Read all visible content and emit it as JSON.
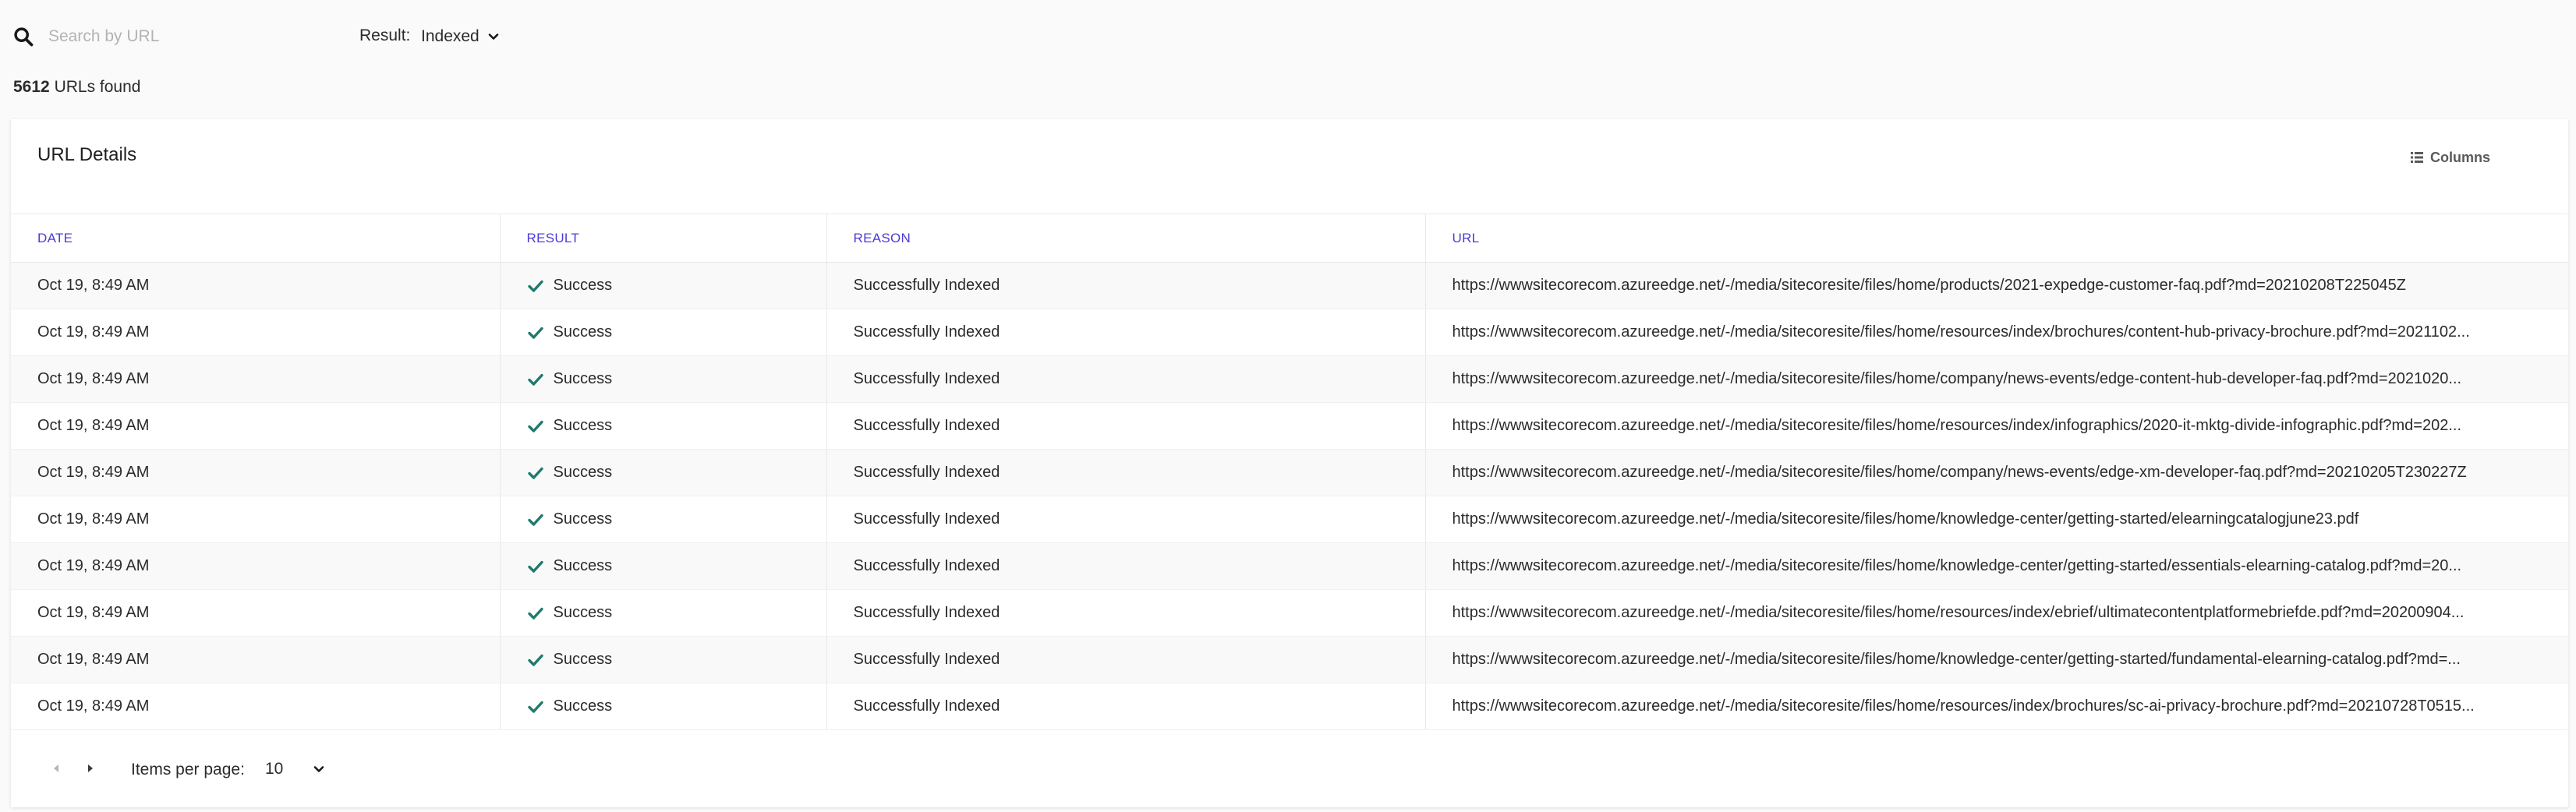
{
  "search": {
    "placeholder": "Search by URL",
    "value": ""
  },
  "filter": {
    "label": "Result:",
    "value": "Indexed"
  },
  "summary": {
    "count": "5612",
    "suffix": "URLs found"
  },
  "card": {
    "title": "URL Details",
    "columns_label": "Columns"
  },
  "table": {
    "headers": [
      "DATE",
      "RESULT",
      "REASON",
      "URL"
    ],
    "rows": [
      {
        "date": "Oct 19, 8:49 AM",
        "result": "Success",
        "reason": "Successfully Indexed",
        "url": "https://wwwsitecorecom.azureedge.net/-/media/sitecoresite/files/home/products/2021-expedge-customer-faq.pdf?md=20210208T225045Z"
      },
      {
        "date": "Oct 19, 8:49 AM",
        "result": "Success",
        "reason": "Successfully Indexed",
        "url": "https://wwwsitecorecom.azureedge.net/-/media/sitecoresite/files/home/resources/index/brochures/content-hub-privacy-brochure.pdf?md=2021102..."
      },
      {
        "date": "Oct 19, 8:49 AM",
        "result": "Success",
        "reason": "Successfully Indexed",
        "url": "https://wwwsitecorecom.azureedge.net/-/media/sitecoresite/files/home/company/news-events/edge-content-hub-developer-faq.pdf?md=2021020..."
      },
      {
        "date": "Oct 19, 8:49 AM",
        "result": "Success",
        "reason": "Successfully Indexed",
        "url": "https://wwwsitecorecom.azureedge.net/-/media/sitecoresite/files/home/resources/index/infographics/2020-it-mktg-divide-infographic.pdf?md=202..."
      },
      {
        "date": "Oct 19, 8:49 AM",
        "result": "Success",
        "reason": "Successfully Indexed",
        "url": "https://wwwsitecorecom.azureedge.net/-/media/sitecoresite/files/home/company/news-events/edge-xm-developer-faq.pdf?md=20210205T230227Z"
      },
      {
        "date": "Oct 19, 8:49 AM",
        "result": "Success",
        "reason": "Successfully Indexed",
        "url": "https://wwwsitecorecom.azureedge.net/-/media/sitecoresite/files/home/knowledge-center/getting-started/elearningcatalogjune23.pdf"
      },
      {
        "date": "Oct 19, 8:49 AM",
        "result": "Success",
        "reason": "Successfully Indexed",
        "url": "https://wwwsitecorecom.azureedge.net/-/media/sitecoresite/files/home/knowledge-center/getting-started/essentials-elearning-catalog.pdf?md=20..."
      },
      {
        "date": "Oct 19, 8:49 AM",
        "result": "Success",
        "reason": "Successfully Indexed",
        "url": "https://wwwsitecorecom.azureedge.net/-/media/sitecoresite/files/home/resources/index/ebrief/ultimatecontentplatformebriefde.pdf?md=20200904..."
      },
      {
        "date": "Oct 19, 8:49 AM",
        "result": "Success",
        "reason": "Successfully Indexed",
        "url": "https://wwwsitecorecom.azureedge.net/-/media/sitecoresite/files/home/knowledge-center/getting-started/fundamental-elearning-catalog.pdf?md=..."
      },
      {
        "date": "Oct 19, 8:49 AM",
        "result": "Success",
        "reason": "Successfully Indexed",
        "url": "https://wwwsitecorecom.azureedge.net/-/media/sitecoresite/files/home/resources/index/brochures/sc-ai-privacy-brochure.pdf?md=20210728T0515..."
      }
    ]
  },
  "pagination": {
    "items_per_page_label": "Items per page:",
    "items_per_page": "10"
  },
  "icons": {
    "search": "search-icon",
    "dropdown": "chevron-down-icon",
    "columns": "list-icon",
    "success": "check-icon",
    "prev": "chevron-left-icon",
    "next": "chevron-right-icon"
  },
  "colors": {
    "header_text": "#4b3bd8",
    "success_check": "#1f7a6d",
    "background": "#fafafa",
    "card": "#ffffff"
  }
}
